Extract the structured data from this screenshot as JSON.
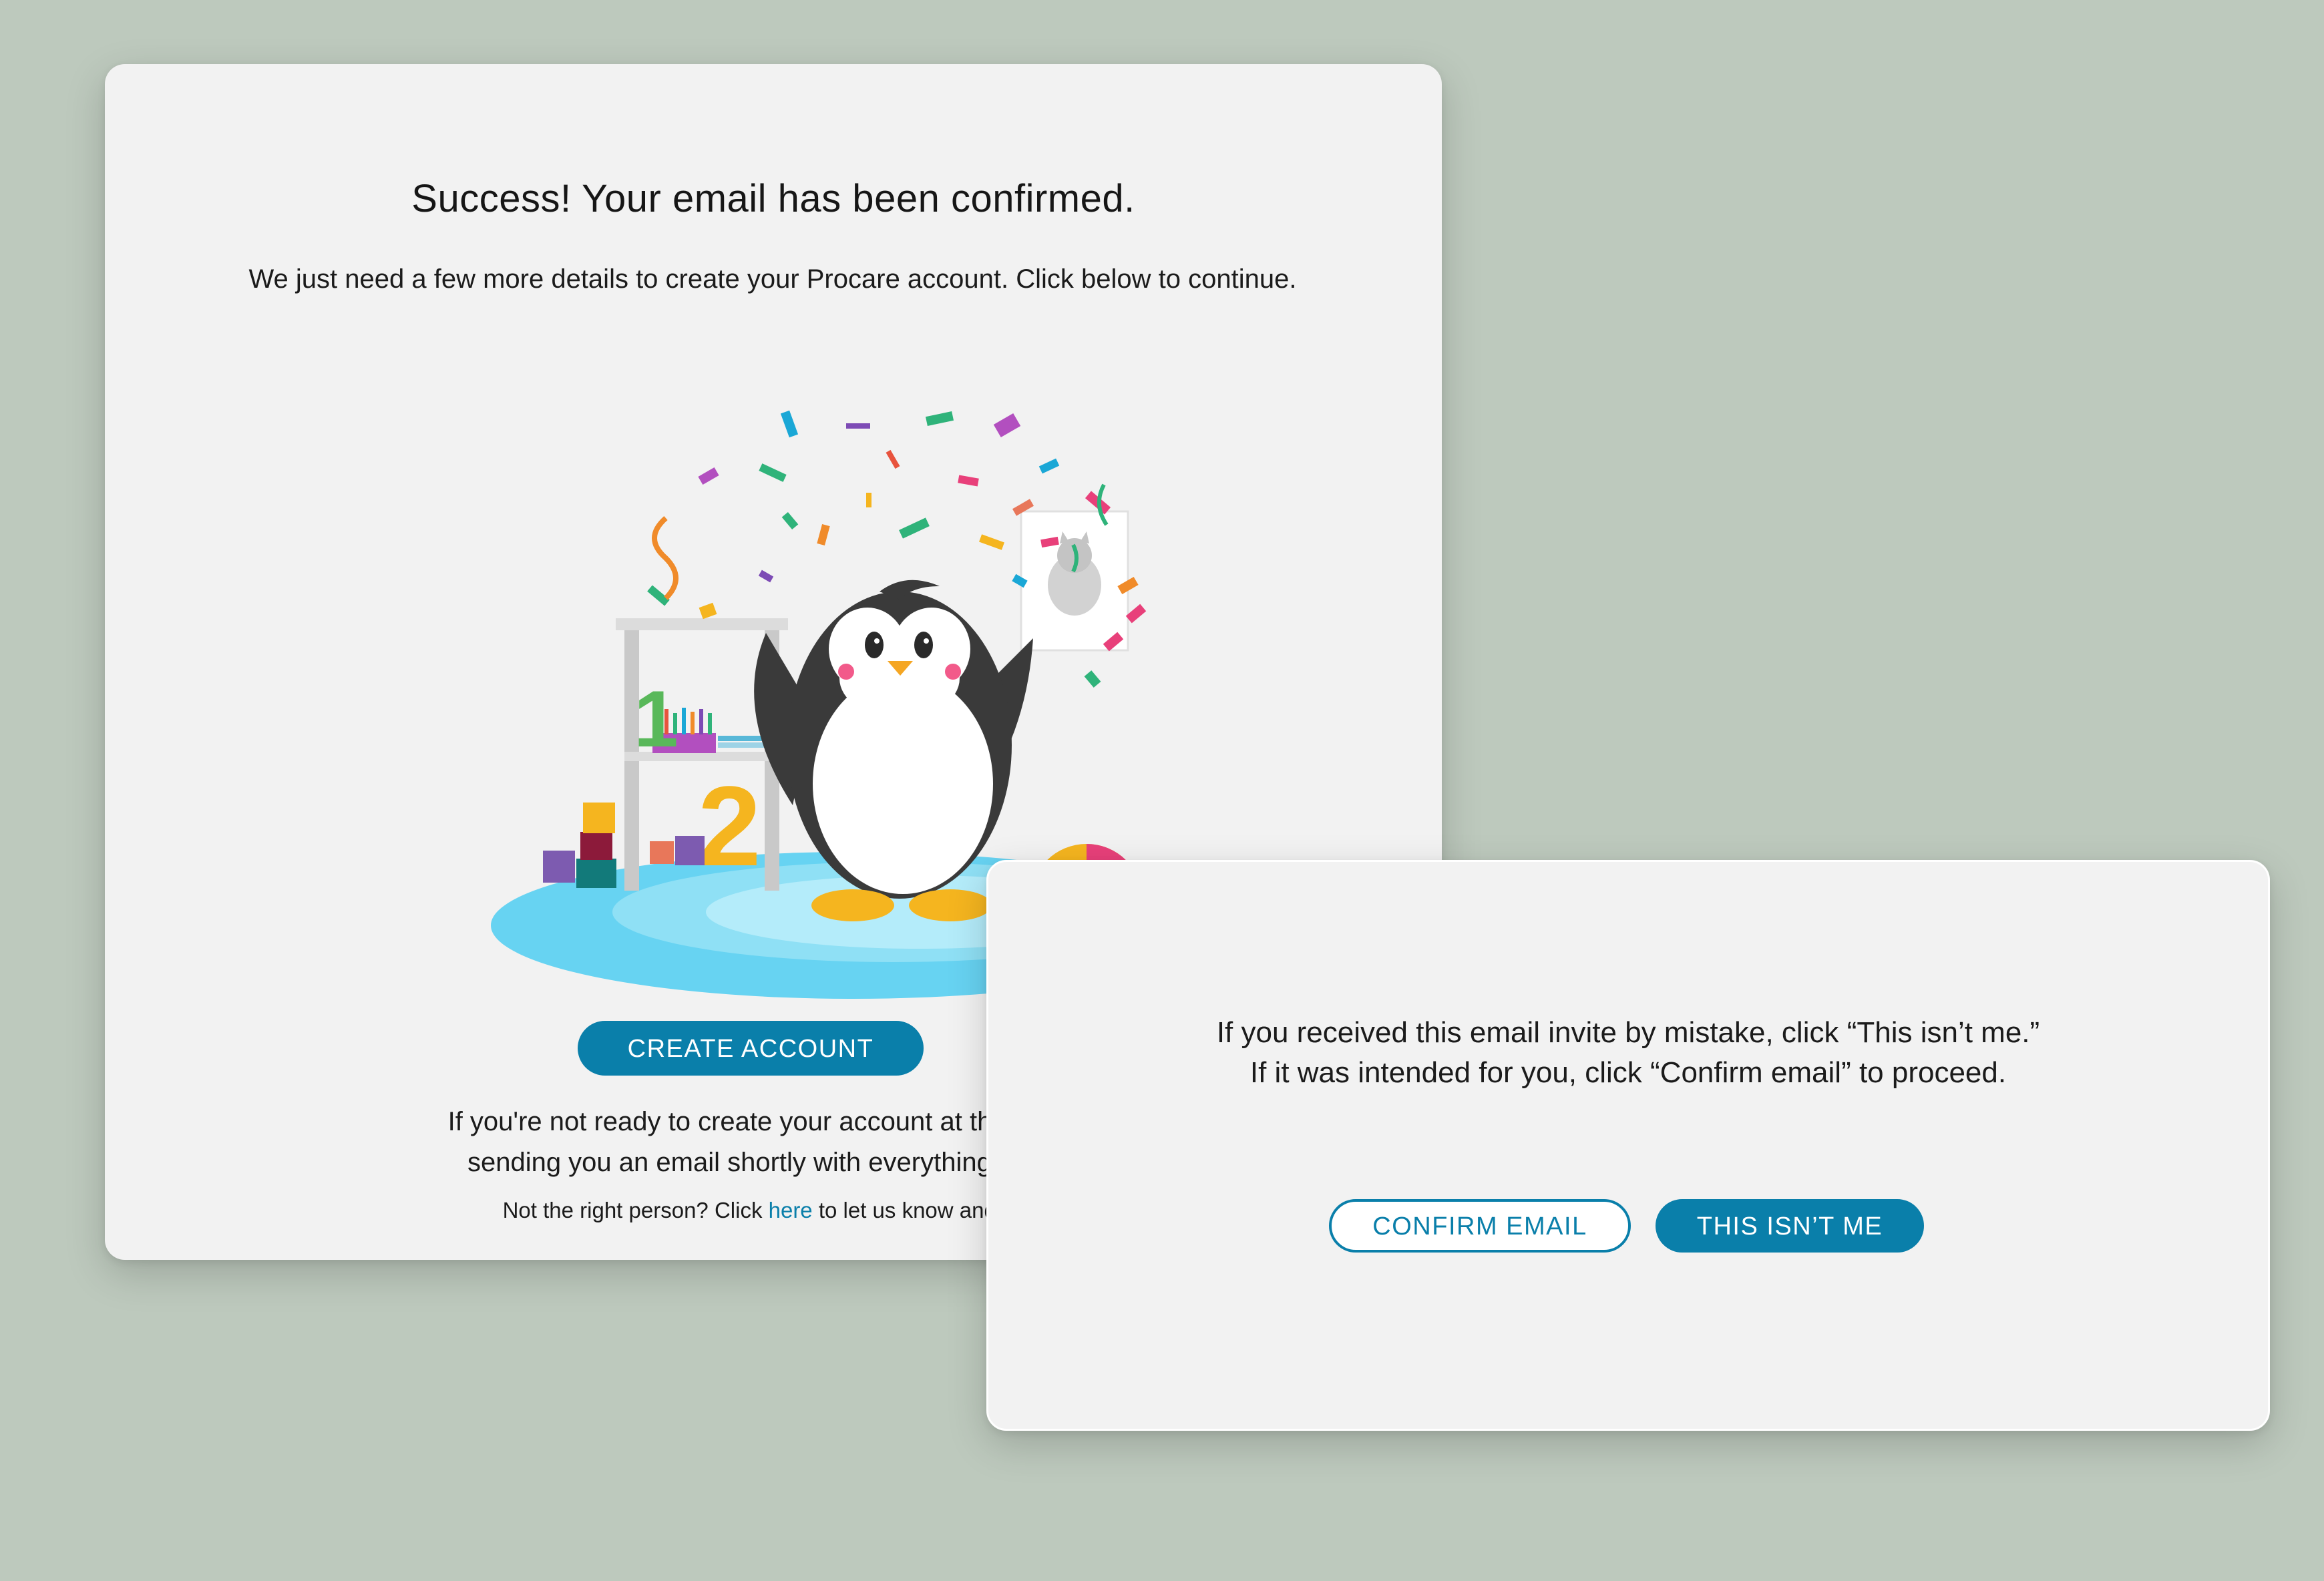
{
  "success_card": {
    "title": "Success! Your email has been confirmed.",
    "subtitle": "We just need a few more details to create your Procare account. Click below to continue.",
    "create_account_label": "CREATE ACCOUNT",
    "note_line1": "If you're not ready to create your account at this time, n",
    "note_line2": "sending you an email shortly with everything you ne",
    "small_note_prefix": "Not the right person? Click ",
    "small_note_link": "here",
    "small_note_suffix": " to let us know and stop",
    "illustration": {
      "shelf_numbers": [
        "1",
        "2"
      ]
    }
  },
  "mistake_card": {
    "line1": "If you received this email invite by mistake, click “This isn’t me.”",
    "line2": "If it was intended for you, click “Confirm email” to proceed.",
    "confirm_email_label": "CONFIRM EMAIL",
    "this_isnt_me_label": "THIS ISN’T ME"
  },
  "colors": {
    "background": "#bdc9bd",
    "card": "#f2f2f2",
    "accent": "#0a7faa",
    "rug": "#67d3f2",
    "penguin_body": "#3a3a3a"
  }
}
